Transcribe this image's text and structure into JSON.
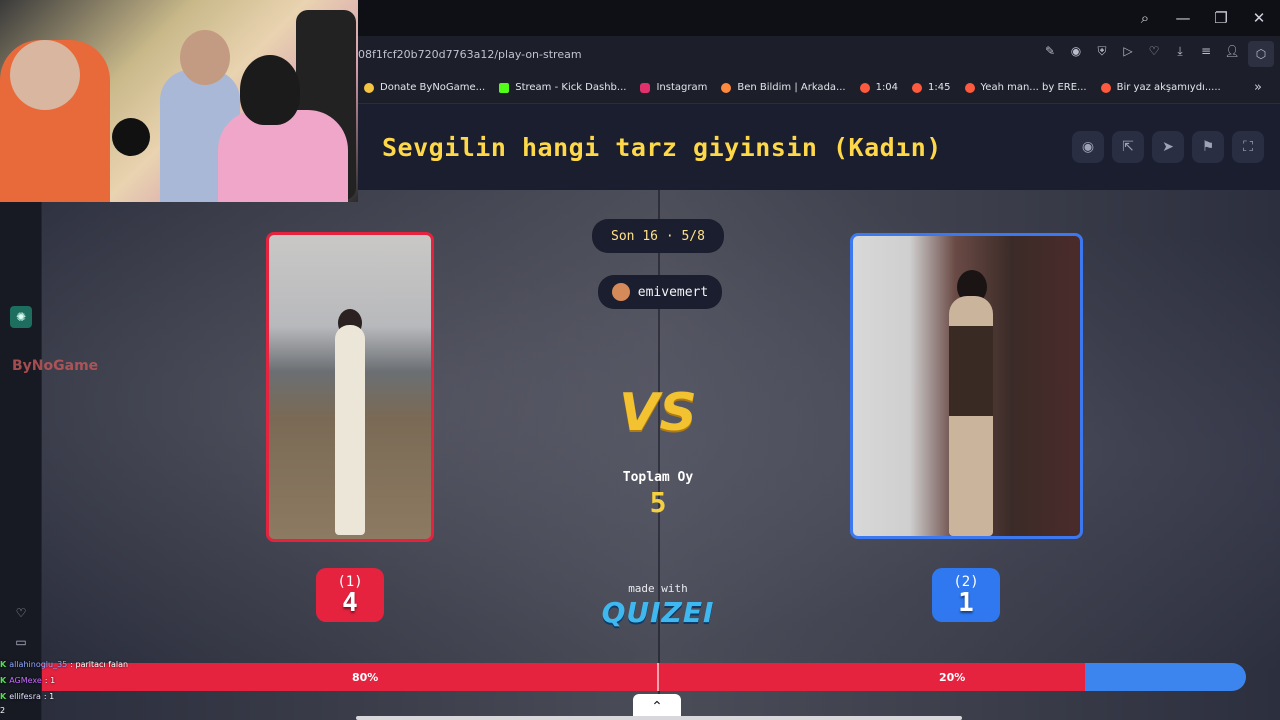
{
  "browser": {
    "url": "08f1fcf20b720d7763a12/play-on-stream",
    "bookmarks": [
      {
        "label": "Donate ByNoGame...",
        "color": "#f5c542"
      },
      {
        "label": "Stream - Kick Dashb...",
        "color": "#53fc18"
      },
      {
        "label": "Instagram",
        "color": "#e1306c"
      },
      {
        "label": "Ben Bildim | Arkada...",
        "color": "#ff8a3d"
      },
      {
        "label": "1:04",
        "color": "#ff5a3d"
      },
      {
        "label": "1:45",
        "color": "#ff5a3d"
      },
      {
        "label": "Yeah man... by ERE...",
        "color": "#ff5a3d"
      },
      {
        "label": "Bir yaz akşamıydı.....",
        "color": "#ff5a3d"
      }
    ]
  },
  "sidebar": {
    "watermark": "ByNoGame"
  },
  "quiz": {
    "title": "Sevgilin hangi tarz giyinsin (Kadın)",
    "round": "Son 16 · 5/8",
    "username": "emivemert",
    "vs_text": "VS",
    "total_label": "Toplam Oy",
    "total_value": "5",
    "options": [
      {
        "key": "(1)",
        "votes": "4",
        "percent_label": "80%",
        "color": "#e5233f"
      },
      {
        "key": "(2)",
        "votes": "1",
        "percent_label": "20%",
        "color": "#2f78f0"
      }
    ],
    "vote_share": {
      "left": 0.8,
      "right": 0.2
    },
    "made_with": "made with",
    "brand": "QUIZEI"
  },
  "chat": [
    {
      "user": "allahinoglu_35",
      "msg": ": parltacı falan"
    },
    {
      "user": "AGMexe",
      "msg": ": 1"
    },
    {
      "user": "ellifesra",
      "msg": ": 1"
    }
  ],
  "corner_text": "2"
}
